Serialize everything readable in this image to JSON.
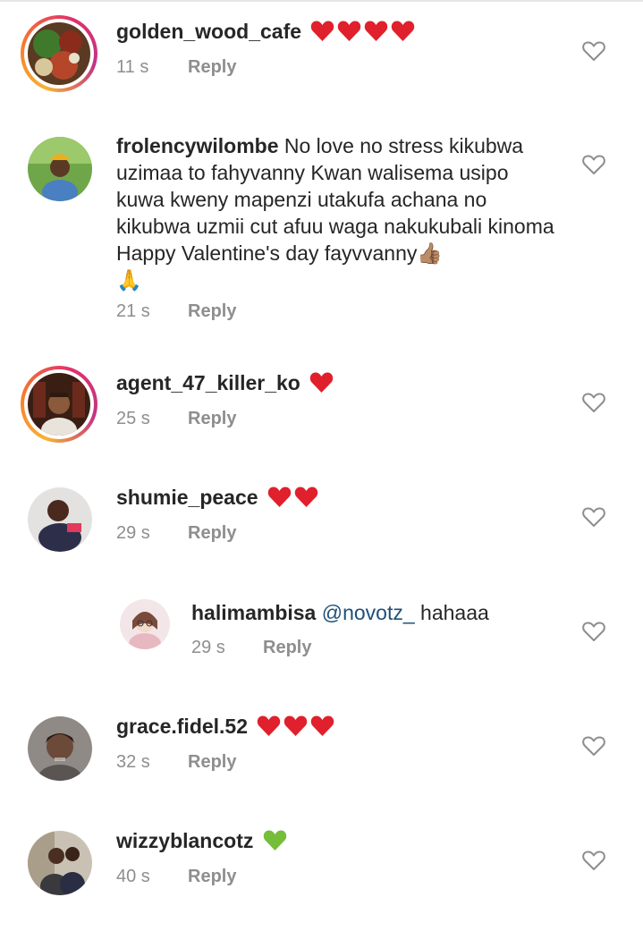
{
  "reply_label": "Reply",
  "colors": {
    "text": "#262626",
    "meta": "#8e8e8e",
    "mention": "#1f4f7a",
    "red_heart": "#e0202c",
    "green_heart": "#76bd3a"
  },
  "comments": [
    {
      "username": "golden_wood_cafe",
      "text": "",
      "emoji": [
        "red-heart",
        "red-heart",
        "red-heart",
        "red-heart"
      ],
      "time": "11 s",
      "story_ring": true
    },
    {
      "username": "frolencywilombe",
      "text": "No love no stress kikubwa uzimaa to fahyvanny Kwan walisema usipo kuwa kweny mapenzi utakufa achana no kikubwa uzmii cut afuu waga nakukubali kinoma Happy Valentine's day fayvvanny👍🏽",
      "extra_emoji": "🙏",
      "time": "21 s",
      "story_ring": false
    },
    {
      "username": "agent_47_killer_ko",
      "text": "",
      "emoji": [
        "red-heart"
      ],
      "time": "25 s",
      "story_ring": true
    },
    {
      "username": "shumie_peace",
      "text": "",
      "emoji": [
        "red-heart",
        "red-heart"
      ],
      "time": "29 s",
      "story_ring": false
    },
    {
      "username": "halimambisa",
      "mention": "@novotz_",
      "text": " hahaaa",
      "time": "29 s",
      "story_ring": false,
      "is_reply": true
    },
    {
      "username": "grace.fidel.52",
      "text": "",
      "emoji": [
        "red-heart",
        "red-heart",
        "red-heart"
      ],
      "time": "32 s",
      "story_ring": false
    },
    {
      "username": "wizzyblancotz",
      "text": "",
      "emoji": [
        "green-heart"
      ],
      "time": "40 s",
      "story_ring": false
    }
  ]
}
